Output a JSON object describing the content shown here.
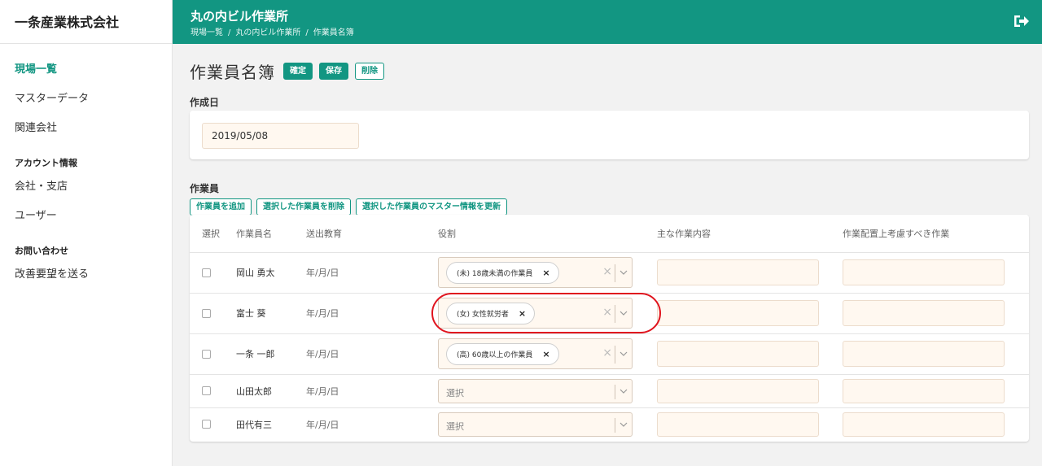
{
  "sidebar": {
    "brand": "一条産業株式会社",
    "nav": [
      {
        "label": "現場一覧",
        "active": true
      },
      {
        "label": "マスターデータ"
      },
      {
        "label": "関連会社"
      }
    ],
    "account_heading": "アカウント情報",
    "account_items": [
      "会社・支店",
      "ユーザー"
    ],
    "contact_heading": "お問い合わせ",
    "contact_items": [
      "改善要望を送る"
    ]
  },
  "header": {
    "site_name": "丸の内ビル作業所",
    "breadcrumb": [
      "現場一覧",
      "丸の内ビル作業所",
      "作業員名簿"
    ],
    "breadcrumb_sep": "/",
    "logout_icon": "logout-icon"
  },
  "page": {
    "title": "作業員名簿",
    "buttons": {
      "confirm": "確定",
      "save": "保存",
      "delete": "削除"
    }
  },
  "creation_date": {
    "label": "作成日",
    "value": "2019/05/08"
  },
  "workers": {
    "label": "作業員",
    "actions": {
      "add": "作業員を追加",
      "delete_selected": "選択した作業員を削除",
      "update_master": "選択した作業員のマスター情報を更新"
    },
    "columns": {
      "select": "選択",
      "name": "作業員名",
      "education": "送出教育",
      "role": "役割",
      "main_work": "主な作業内容",
      "consideration": "作業配置上考慮すべき作業"
    },
    "rows": [
      {
        "name": "岡山 勇太",
        "education": "年/月/日",
        "role": "(未) 18歳未満の作業員"
      },
      {
        "name": "富士 葵",
        "education": "年/月/日",
        "role": "(女) 女性就労者"
      },
      {
        "name": "一条 一郎",
        "education": "年/月/日",
        "role": "(高) 60歳以上の作業員"
      },
      {
        "name": "山田太郎",
        "education": "年/月/日",
        "role_placeholder": "選択"
      },
      {
        "name": "田代有三",
        "education": "年/月/日",
        "role_placeholder": "選択"
      }
    ]
  },
  "colors": {
    "accent": "#129682",
    "field_bg": "#fff8f0",
    "highlight": "#e0141e"
  }
}
